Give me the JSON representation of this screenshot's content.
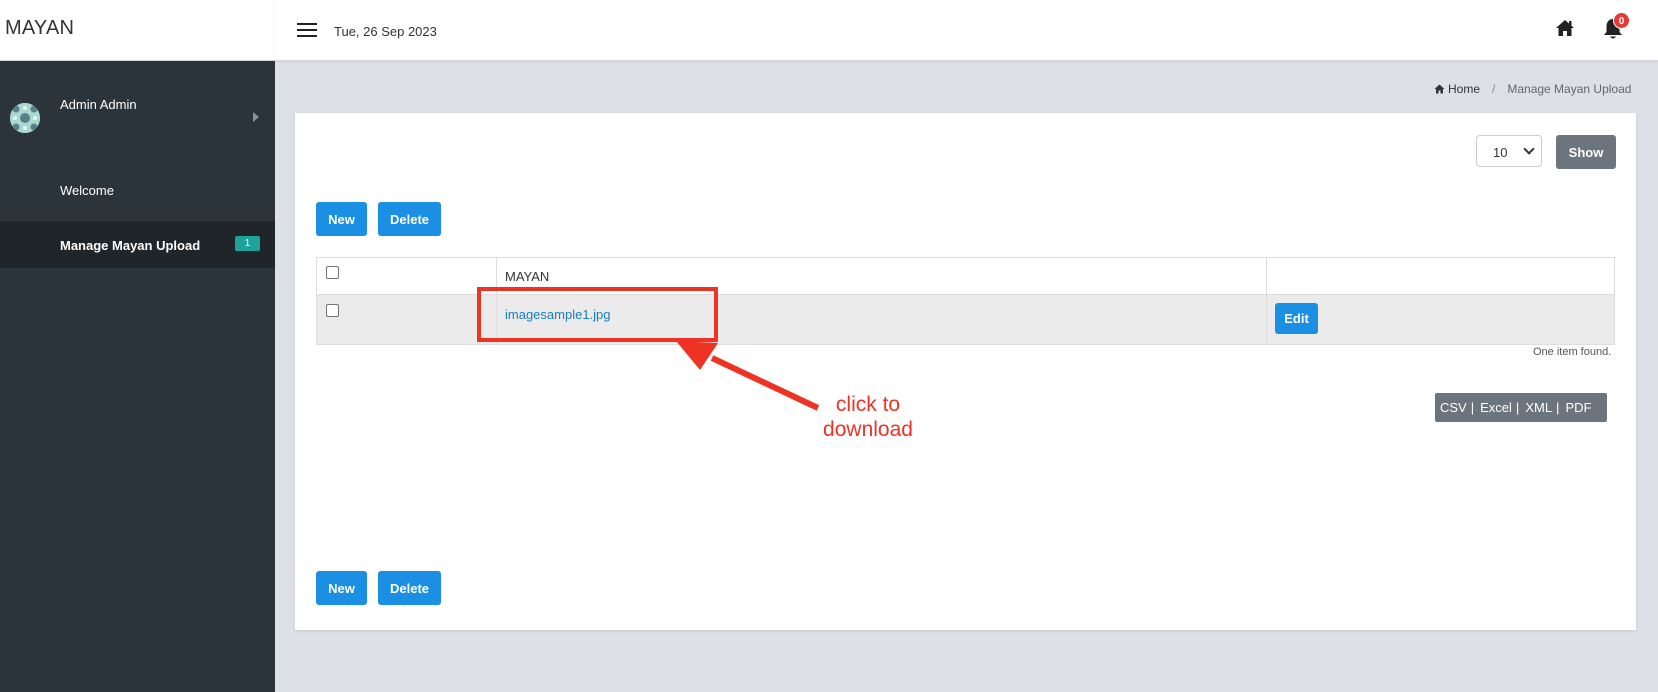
{
  "brand": {
    "title": "MAYAN"
  },
  "topbar": {
    "date": "Tue, 26 Sep 2023",
    "notification_count": "0"
  },
  "sidebar": {
    "user_name": "Admin Admin",
    "items": [
      {
        "label": "Welcome"
      },
      {
        "label": "Manage Mayan Upload",
        "badge": "1",
        "active": true
      }
    ]
  },
  "breadcrumb": {
    "home": "Home",
    "separator": "/",
    "current": "Manage Mayan Upload"
  },
  "toolbar": {
    "page_size": "10",
    "show_label": "Show",
    "new_label": "New",
    "delete_label": "Delete"
  },
  "table": {
    "columns": [
      "",
      "MAYAN",
      ""
    ],
    "rows": [
      {
        "file": "imagesample1.jpg",
        "edit_label": "Edit"
      }
    ],
    "footer": "One item found."
  },
  "export": {
    "csv": "CSV",
    "excel": "Excel",
    "xml": "XML",
    "pdf": "PDF",
    "separator": "|"
  },
  "annotation": {
    "line1": "click to",
    "line2": "download",
    "color": "#ee3324"
  },
  "colors": {
    "primary": "#1a8fe3",
    "sidebar": "#2c343b",
    "badge": "#1ba39c",
    "secondary": "#6c757d"
  }
}
